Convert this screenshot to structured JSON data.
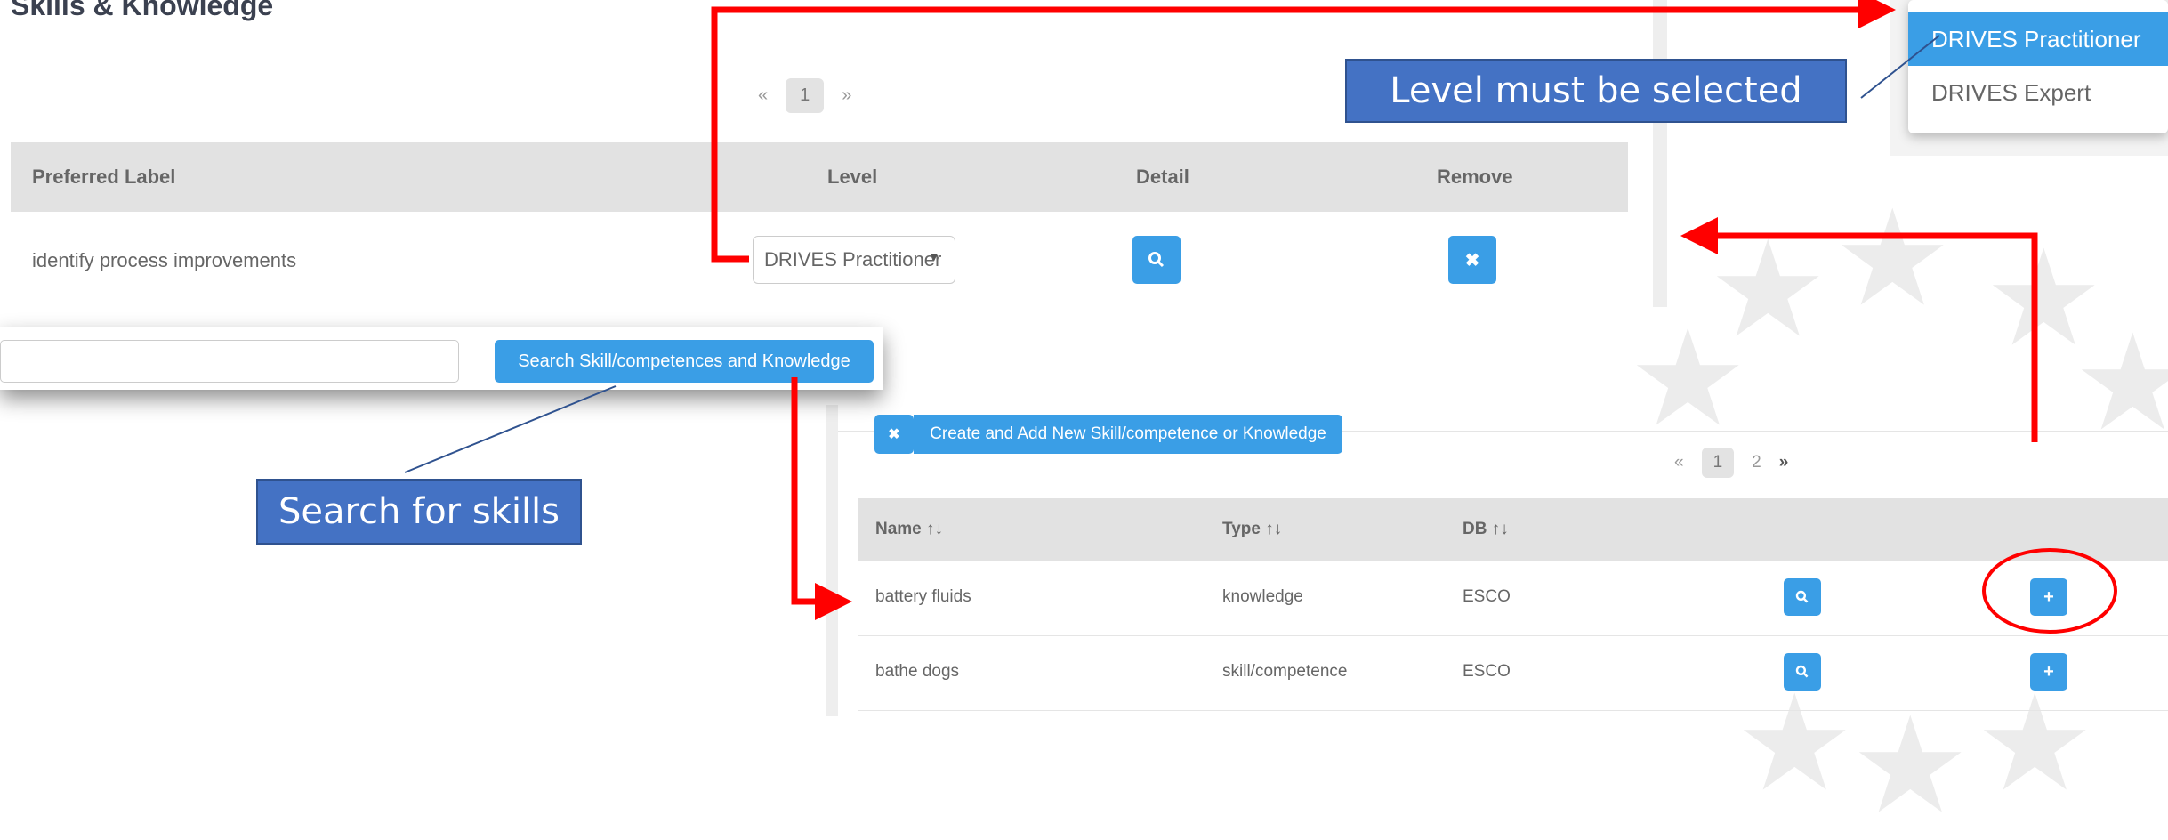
{
  "page": {
    "title": "Skills & Knowledge"
  },
  "top_pager": {
    "prev": "«",
    "current": "1",
    "next": "»"
  },
  "skills_table": {
    "headers": [
      "Preferred Label",
      "Level",
      "Detail",
      "Remove"
    ],
    "rows": [
      {
        "label": "identify process improvements",
        "level": "DRIVES Practitioner"
      }
    ]
  },
  "level_dropdown": {
    "options": [
      "DRIVES Practitioner",
      "DRIVES Expert"
    ],
    "selected": "DRIVES Practitioner"
  },
  "search": {
    "input_value": "",
    "button_label": "Search Skill/competences and Knowledge"
  },
  "create_panel": {
    "close_label": "×",
    "create_button": "Create and Add New Skill/competence or Knowledge",
    "pager": {
      "prev": "«",
      "pages": [
        "1",
        "2"
      ],
      "next": "»"
    },
    "headers": [
      "Name ↑↓",
      "Type ↑↓",
      "DB ↑↓"
    ],
    "rows": [
      {
        "name": "battery fluids",
        "type": "knowledge",
        "db": "ESCO"
      },
      {
        "name": "bathe dogs",
        "type": "skill/competence",
        "db": "ESCO"
      }
    ]
  },
  "callouts": {
    "level": "Level must be selected",
    "search": "Search for skills"
  },
  "colors": {
    "accent": "#3a9ee6",
    "arrow": "#ff0000",
    "callout": "#4472c4"
  }
}
